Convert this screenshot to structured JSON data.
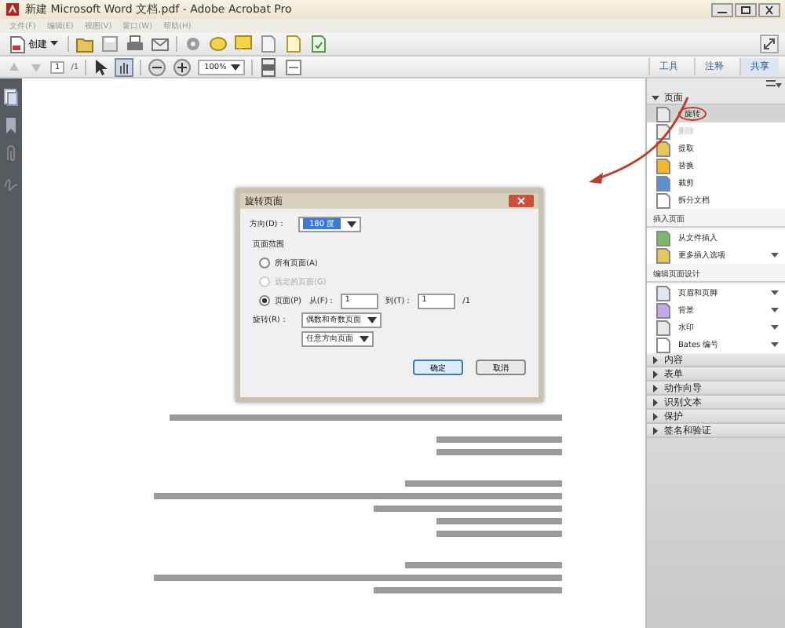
{
  "window": {
    "title": "新建 Microsoft Word 文档.pdf - Adobe Acrobat Pro"
  },
  "menu": [
    "文件(F)",
    "编辑(E)",
    "视图(V)",
    "窗口(W)",
    "帮助(H)"
  ],
  "toolbar": {
    "create_label": "创建"
  },
  "navigation": {
    "page": "1",
    "page_count": "/1",
    "zoom": "100%"
  },
  "panel_tabs": [
    {
      "label": "工具",
      "selected": false
    },
    {
      "label": "注释",
      "selected": false
    },
    {
      "label": "共享",
      "selected": true
    }
  ],
  "sections": [
    {
      "title": "页面",
      "expanded": true,
      "groups": [
        {
          "items": [
            {
              "label": "旋转",
              "disabled": false,
              "highlighted": true
            },
            {
              "label": "删除",
              "disabled": true,
              "highlighted": false
            },
            {
              "label": "提取",
              "disabled": false,
              "highlighted": false
            },
            {
              "label": "替换",
              "disabled": false,
              "highlighted": false
            },
            {
              "label": "裁剪",
              "disabled": false,
              "highlighted": false
            },
            {
              "label": "拆分文档",
              "disabled": false,
              "highlighted": false
            }
          ]
        },
        {
          "title": "插入页面",
          "items": [
            {
              "label": "从文件插入",
              "disabled": false,
              "highlighted": false,
              "dropdown": false
            },
            {
              "label": "更多插入选项",
              "disabled": false,
              "highlighted": false,
              "dropdown": true
            }
          ]
        },
        {
          "title": "编辑页面设计",
          "items": [
            {
              "label": "页眉和页脚",
              "disabled": false,
              "highlighted": false,
              "dropdown": true
            },
            {
              "label": "背景",
              "disabled": false,
              "highlighted": false,
              "dropdown": true
            },
            {
              "label": "水印",
              "disabled": false,
              "highlighted": false,
              "dropdown": true
            },
            {
              "label": "Bates 编号",
              "disabled": false,
              "highlighted": false,
              "dropdown": true
            }
          ]
        }
      ]
    },
    {
      "title": "内容",
      "expanded": false
    },
    {
      "title": "表单",
      "expanded": false
    },
    {
      "title": "动作向导",
      "expanded": false
    },
    {
      "title": "识别文本",
      "expanded": false
    },
    {
      "title": "保护",
      "expanded": false
    },
    {
      "title": "签名和验证",
      "expanded": false
    }
  ],
  "dialog": {
    "title": "旋转页面",
    "direction_label": "方向(D)：",
    "direction_value": "180 度",
    "range_label": "页面范围",
    "range_options": [
      {
        "label": "所有页面(A)",
        "selected": false,
        "disabled": false
      },
      {
        "label": "选定的页面(G)",
        "selected": false,
        "disabled": true
      },
      {
        "label": "页面(P)",
        "selected": true,
        "disabled": false
      }
    ],
    "from_label": "从(F)：",
    "from_value": "1",
    "to_label": "到(T)：",
    "to_value": "1",
    "total": "/1",
    "rotate_label": "旋转(R)：",
    "rotate_value": "偶数和奇数页面",
    "orientation_value": "任意方向页面",
    "buttons": [
      "确定",
      "取消"
    ]
  }
}
